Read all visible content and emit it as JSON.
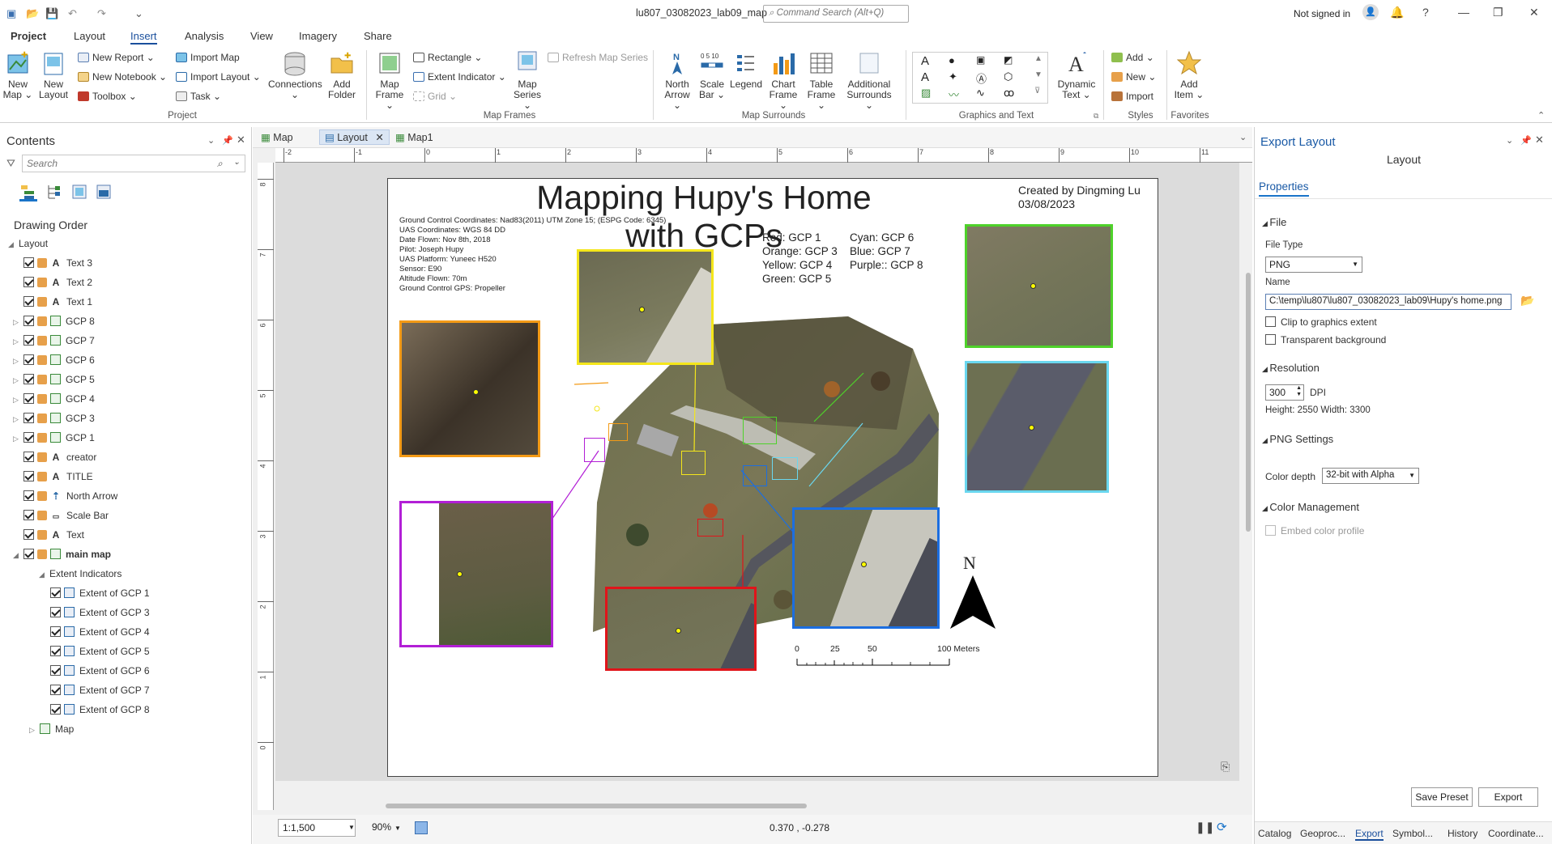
{
  "window": {
    "title": "lu807_03082023_lab09_map",
    "command_search": "Command Search (Alt+Q)",
    "signin": "Not signed in"
  },
  "menu": [
    "Project",
    "Layout",
    "Insert",
    "Analysis",
    "View",
    "Imagery",
    "Share"
  ],
  "ribbon": {
    "project": {
      "new_map": "New Map",
      "new_layout": "New Layout",
      "new_report": "New Report",
      "new_notebook": "New Notebook",
      "toolbox": "Toolbox",
      "import_map": "Import Map",
      "import_layout": "Import Layout",
      "task": "Task",
      "connections": "Connections",
      "add_folder": "Add Folder",
      "group": "Project"
    },
    "mapframes": {
      "map_frame": "Map Frame",
      "rectangle": "Rectangle",
      "extent_indicator": "Extent Indicator",
      "grid": "Grid",
      "map_series": "Map Series",
      "refresh": "Refresh Map Series",
      "group": "Map Frames"
    },
    "surrounds": {
      "north_arrow": "North Arrow",
      "scale_bar": "Scale Bar",
      "legend": "Legend",
      "chart_frame": "Chart Frame",
      "table_frame": "Table Frame",
      "additional": "Additional Surrounds",
      "group": "Map Surrounds"
    },
    "graphics": {
      "dynamic_text": "Dynamic Text",
      "group": "Graphics and Text"
    },
    "styles": {
      "add": "Add",
      "new": "New",
      "import": "Import",
      "group": "Styles"
    },
    "favorites": {
      "add_item": "Add Item",
      "group": "Favorites"
    }
  },
  "contents": {
    "title": "Contents",
    "search_placeholder": "Search",
    "drawing_order": "Drawing Order",
    "items": [
      {
        "label": "Layout",
        "kind": "root"
      },
      {
        "label": "Text 3",
        "kind": "text"
      },
      {
        "label": "Text 2",
        "kind": "text"
      },
      {
        "label": "Text 1",
        "kind": "text"
      },
      {
        "label": "GCP 8",
        "kind": "frame"
      },
      {
        "label": "GCP 7",
        "kind": "frame"
      },
      {
        "label": "GCP 6",
        "kind": "frame"
      },
      {
        "label": "GCP 5",
        "kind": "frame"
      },
      {
        "label": "GCP 4",
        "kind": "frame"
      },
      {
        "label": "GCP 3",
        "kind": "frame"
      },
      {
        "label": "GCP 1",
        "kind": "frame"
      },
      {
        "label": "creator",
        "kind": "text"
      },
      {
        "label": "TITLE",
        "kind": "text"
      },
      {
        "label": "North Arrow",
        "kind": "north"
      },
      {
        "label": "Scale Bar",
        "kind": "scale"
      },
      {
        "label": "Text",
        "kind": "text"
      },
      {
        "label": "main map",
        "kind": "frame"
      },
      {
        "label": "Extent Indicators",
        "kind": "group"
      },
      {
        "label": "Extent of GCP 1",
        "kind": "extent"
      },
      {
        "label": "Extent of GCP 3",
        "kind": "extent"
      },
      {
        "label": "Extent of GCP 4",
        "kind": "extent"
      },
      {
        "label": "Extent of GCP 5",
        "kind": "extent"
      },
      {
        "label": "Extent of GCP 6",
        "kind": "extent"
      },
      {
        "label": "Extent of GCP 7",
        "kind": "extent"
      },
      {
        "label": "Extent of GCP 8",
        "kind": "extent"
      },
      {
        "label": "Map",
        "kind": "map"
      }
    ]
  },
  "tabs": [
    "Map",
    "Layout",
    "Map1"
  ],
  "layout": {
    "title": "Mapping Hupy's Home with GCPs",
    "creator": "Created by Dingming Lu",
    "date": "03/08/2023",
    "info": [
      "Ground Control Coordinates: Nad83(2011) UTM Zone 15; (ESPG Code: 6345)",
      "UAS Coordinates: WGS 84 DD",
      "Date Flown: Nov 8th, 2018",
      "Pilot: Joseph Hupy",
      "UAS Platform: Yuneec H520",
      "Sensor: E90",
      "Altitude Flown: 70m",
      "Ground Control GPS: Propeller"
    ],
    "legend_left": [
      "Red: GCP 1",
      "Orange: GCP 3",
      "Yellow: GCP 4",
      "Green: GCP 5"
    ],
    "legend_right": [
      "Cyan: GCP 6",
      "Blue: GCP 7",
      "Purple:: GCP 8"
    ],
    "scale_labels": [
      "0",
      "25",
      "50",
      "100 Meters"
    ],
    "north": "N",
    "colors": {
      "red": "#e0141a",
      "orange": "#f39a16",
      "yellow": "#f4e61b",
      "green": "#4ed22a",
      "cyan": "#6ad7ef",
      "blue": "#1c6ee0",
      "purple": "#b21fd6"
    },
    "ruler_top": [
      "-2",
      "-1",
      "0",
      "1",
      "2",
      "3",
      "4",
      "5",
      "6",
      "7",
      "8",
      "9",
      "10",
      "11"
    ],
    "ruler_left": [
      "8",
      "7",
      "6",
      "5",
      "4",
      "3",
      "2",
      "1",
      "0"
    ]
  },
  "status": {
    "scale": "1:1,500",
    "zoom": "90%",
    "coords": "0.370 , -0.278"
  },
  "export": {
    "title": "Export Layout",
    "subtitle": "Layout",
    "properties": "Properties",
    "file": "File",
    "file_type_label": "File Type",
    "file_type": "PNG",
    "name_label": "Name",
    "name": "C:\\temp\\lu807\\lu807_03082023_lab09\\Hupy's home.png",
    "clip": "Clip to graphics extent",
    "transparent": "Transparent background",
    "resolution": "Resolution",
    "dpi": "300",
    "dpi_label": "DPI",
    "size": "Height: 2550 Width: 3300",
    "png_settings": "PNG Settings",
    "color_depth_label": "Color depth",
    "color_depth": "32-bit with Alpha",
    "color_mgmt": "Color Management",
    "embed": "Embed color profile",
    "save_preset": "Save Preset",
    "export_btn": "Export",
    "bottom_tabs": [
      "Catalog",
      "Geoproc...",
      "Export",
      "Symbol...",
      "History",
      "Coordinate..."
    ]
  }
}
